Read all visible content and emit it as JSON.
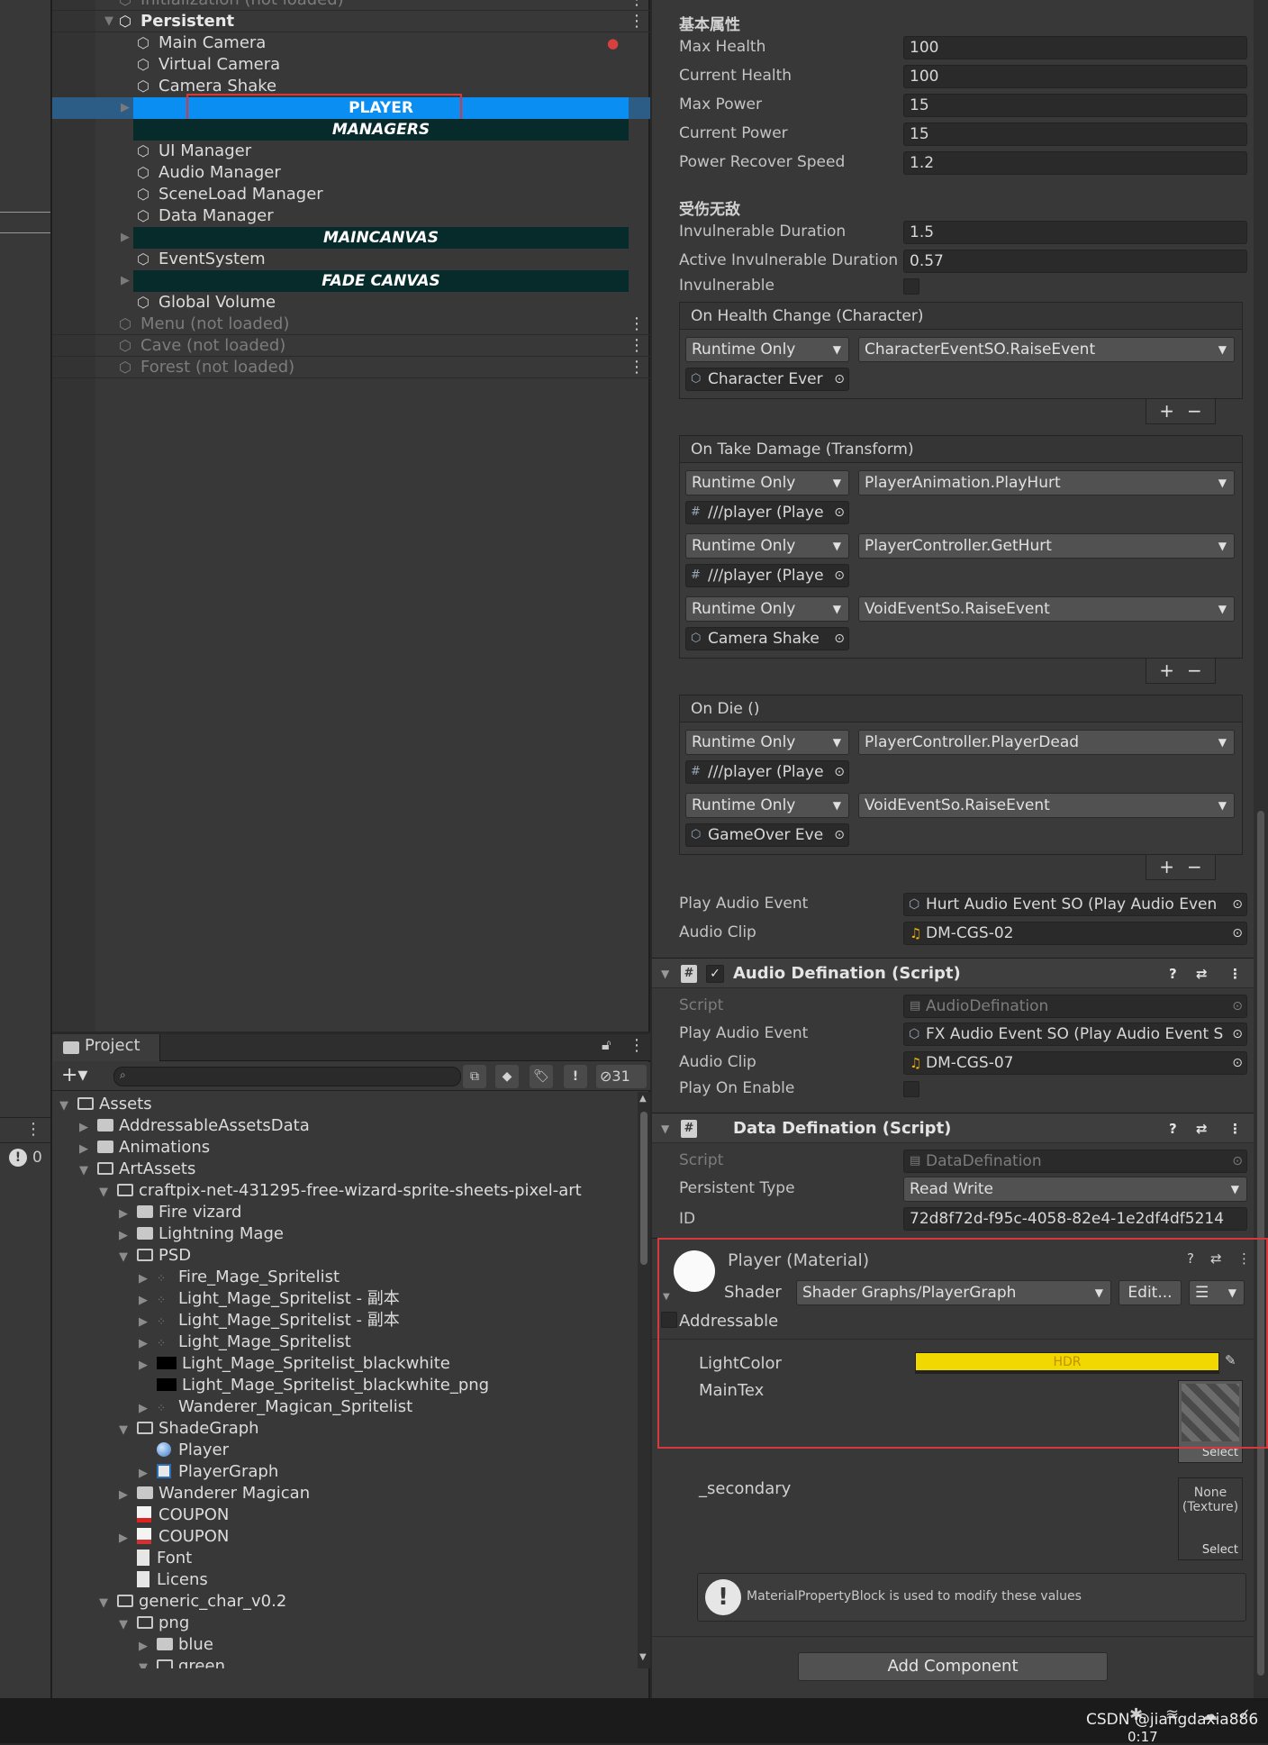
{
  "hierarchy": {
    "rows": [
      {
        "text": "Initialization (not loaded)",
        "indent": 0,
        "type": "scene-faded"
      },
      {
        "text": "Persistent",
        "indent": 0,
        "type": "scene"
      },
      {
        "text": "Main Camera",
        "indent": 1,
        "type": "obj"
      },
      {
        "text": "Virtual Camera",
        "indent": 1,
        "type": "obj"
      },
      {
        "text": "Camera Shake",
        "indent": 1,
        "type": "obj"
      },
      {
        "text": "PLAYER",
        "indent": 1,
        "type": "selected"
      },
      {
        "text": "MANAGERS",
        "indent": 1,
        "type": "header"
      },
      {
        "text": "UI Manager",
        "indent": 1,
        "type": "obj"
      },
      {
        "text": "Audio Manager",
        "indent": 1,
        "type": "obj"
      },
      {
        "text": "SceneLoad Manager",
        "indent": 1,
        "type": "obj"
      },
      {
        "text": "Data Manager",
        "indent": 1,
        "type": "obj"
      },
      {
        "text": "MAINCANVAS",
        "indent": 1,
        "type": "header"
      },
      {
        "text": "EventSystem",
        "indent": 1,
        "type": "obj"
      },
      {
        "text": "FADE CANVAS",
        "indent": 1,
        "type": "header"
      },
      {
        "text": "Global Volume",
        "indent": 1,
        "type": "obj"
      },
      {
        "text": "Menu (not loaded)",
        "indent": 0,
        "type": "scene-faded"
      },
      {
        "text": "Cave (not loaded)",
        "indent": 0,
        "type": "scene-faded"
      },
      {
        "text": "Forest (not loaded)",
        "indent": 0,
        "type": "scene-faded"
      }
    ]
  },
  "project": {
    "tab": "Project",
    "hidden_count": "31",
    "console_count": "0",
    "rows": [
      {
        "text": "Assets",
        "depth": 0,
        "icon": "folder-open",
        "arrow": "open"
      },
      {
        "text": "AddressableAssetsData",
        "depth": 1,
        "icon": "folder",
        "arrow": "closed"
      },
      {
        "text": "Animations",
        "depth": 1,
        "icon": "folder",
        "arrow": "closed"
      },
      {
        "text": "ArtAssets",
        "depth": 1,
        "icon": "folder-open",
        "arrow": "open"
      },
      {
        "text": "craftpix-net-431295-free-wizard-sprite-sheets-pixel-art",
        "depth": 2,
        "icon": "folder-open",
        "arrow": "open"
      },
      {
        "text": "Fire vizard",
        "depth": 3,
        "icon": "folder",
        "arrow": "closed"
      },
      {
        "text": "Lightning Mage",
        "depth": 3,
        "icon": "folder",
        "arrow": "closed"
      },
      {
        "text": "PSD",
        "depth": 3,
        "icon": "folder-open",
        "arrow": "open"
      },
      {
        "text": "Fire_Mage_Spritelist",
        "depth": 4,
        "icon": "sprite",
        "arrow": "closed"
      },
      {
        "text": "Light_Mage_Spritelist - 副本",
        "depth": 4,
        "icon": "sprite",
        "arrow": "closed"
      },
      {
        "text": "Light_Mage_Spritelist - 副本",
        "depth": 4,
        "icon": "sprite",
        "arrow": "closed"
      },
      {
        "text": "Light_Mage_Spritelist",
        "depth": 4,
        "icon": "sprite",
        "arrow": "closed"
      },
      {
        "text": "Light_Mage_Spritelist_blackwhite",
        "depth": 4,
        "icon": "sprite-black",
        "arrow": "closed"
      },
      {
        "text": "Light_Mage_Spritelist_blackwhite_png",
        "depth": 4,
        "icon": "sprite-black",
        "arrow": "none"
      },
      {
        "text": "Wanderer_Magican_Spritelist",
        "depth": 4,
        "icon": "sprite",
        "arrow": "closed"
      },
      {
        "text": "ShadeGraph",
        "depth": 3,
        "icon": "folder-open",
        "arrow": "open"
      },
      {
        "text": "Player",
        "depth": 4,
        "icon": "material",
        "arrow": "none"
      },
      {
        "text": "PlayerGraph",
        "depth": 4,
        "icon": "shadergraph",
        "arrow": "closed"
      },
      {
        "text": "Wanderer Magican",
        "depth": 3,
        "icon": "folder",
        "arrow": "closed"
      },
      {
        "text": "COUPON",
        "depth": 3,
        "icon": "pdf",
        "arrow": "none"
      },
      {
        "text": "COUPON",
        "depth": 3,
        "icon": "image",
        "arrow": "closed"
      },
      {
        "text": "Font",
        "depth": 3,
        "icon": "doc",
        "arrow": "none"
      },
      {
        "text": "Licens",
        "depth": 3,
        "icon": "doc",
        "arrow": "none"
      },
      {
        "text": "generic_char_v0.2",
        "depth": 2,
        "icon": "folder-open",
        "arrow": "open"
      },
      {
        "text": "png",
        "depth": 3,
        "icon": "folder-open",
        "arrow": "open"
      },
      {
        "text": "blue",
        "depth": 4,
        "icon": "folder",
        "arrow": "closed"
      },
      {
        "text": "green",
        "depth": 4,
        "icon": "folder-open",
        "arrow": "open"
      }
    ]
  },
  "inspector": {
    "section_basic": "基本属性",
    "basic_fields": [
      {
        "label": "Max Health",
        "value": "100"
      },
      {
        "label": "Current Health",
        "value": "100"
      },
      {
        "label": "Max Power",
        "value": "15"
      },
      {
        "label": "Current Power",
        "value": "15"
      },
      {
        "label": "Power Recover Speed",
        "value": "1.2"
      }
    ],
    "section_invuln": "受伤无敌",
    "invuln_fields": [
      {
        "label": "Invulnerable Duration",
        "value": "1.5"
      },
      {
        "label": "Active Invulnerable Duration",
        "value": "0.57"
      }
    ],
    "invulnerable_label": "Invulnerable",
    "events": [
      {
        "title": "On Health Change (Character)",
        "entries": [
          {
            "mode": "Runtime Only",
            "func": "CharacterEventSO.RaiseEvent",
            "obj": "Character Ever",
            "objicon": "so"
          }
        ]
      },
      {
        "title": "On Take Damage (Transform)",
        "entries": [
          {
            "mode": "Runtime Only",
            "func": "PlayerAnimation.PlayHurt",
            "obj": "///player (Playe",
            "objicon": "script"
          },
          {
            "mode": "Runtime Only",
            "func": "PlayerController.GetHurt",
            "obj": "///player (Playe",
            "objicon": "script"
          },
          {
            "mode": "Runtime Only",
            "func": "VoidEventSo.RaiseEvent",
            "obj": "Camera Shake",
            "objicon": "so"
          }
        ]
      },
      {
        "title": "On Die ()",
        "entries": [
          {
            "mode": "Runtime Only",
            "func": "PlayerController.PlayerDead",
            "obj": "///player (Playe",
            "objicon": "script"
          },
          {
            "mode": "Runtime Only",
            "func": "VoidEventSo.RaiseEvent",
            "obj": "GameOver Eve",
            "objicon": "so"
          }
        ]
      }
    ],
    "play_audio_label": "Play Audio Event",
    "play_audio_value": "Hurt Audio Event SO (Play Audio Even",
    "audio_clip_label": "Audio Clip",
    "audio_clip_value": "DM-CGS-02",
    "audio_def": {
      "title": "Audio Defination (Script)",
      "script_label": "Script",
      "script_value": "AudioDefination",
      "play_label": "Play Audio Event",
      "play_value": "FX Audio Event SO (Play Audio Event S",
      "clip_label": "Audio Clip",
      "clip_value": "DM-CGS-07",
      "enable_label": "Play On Enable"
    },
    "data_def": {
      "title": "Data Defination (Script)",
      "script_label": "Script",
      "script_value": "DataDefination",
      "ptype_label": "Persistent Type",
      "ptype_value": "Read Write",
      "id_label": "ID",
      "id_value": "72d8f72d-f95c-4058-82e4-1e2df4df5214"
    },
    "material": {
      "title": "Player (Material)",
      "shader_label": "Shader",
      "shader_value": "Shader Graphs/PlayerGraph",
      "edit_label": "Edit...",
      "addressable_label": "Addressable",
      "lightcolor_label": "LightColor",
      "hdr_label": "HDR",
      "lightcolor": "#f0d800",
      "maintex_label": "MainTex",
      "select_label": "Select",
      "secondary_label": "_secondary",
      "none_texture": "None (Texture)",
      "info": "MaterialPropertyBlock is used to modify these values"
    },
    "add_component": "Add Component"
  },
  "status": {
    "watermark": "CSDN @jiangdaxia886",
    "time": "0:17"
  },
  "colors": {
    "selection": "#0b8ef2",
    "highlight_box": "#d9383a",
    "header_bar": "#072a2a"
  }
}
